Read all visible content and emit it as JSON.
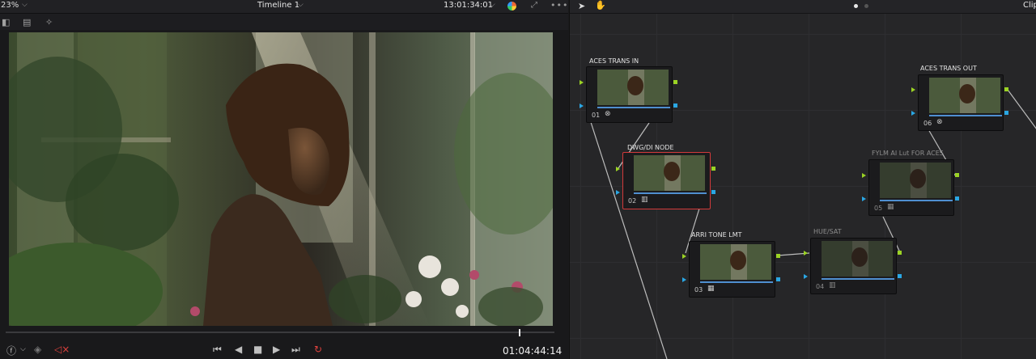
{
  "viewer": {
    "zoom": "23%",
    "timeline_name": "Timeline 1",
    "timecode": "13:01:34:01",
    "playhead_timecode": "01:04:44:14",
    "playhead_position": 0.935
  },
  "node_editor": {
    "mode_label": "Clip",
    "nodes": [
      {
        "id": "01",
        "label": "ACES TRANS IN",
        "icon": "aces-icon",
        "glyph": "⊗",
        "enabled": true,
        "selected": false
      },
      {
        "id": "02",
        "label": "DWG/DI NODE",
        "icon": "scope-icon",
        "glyph": "▥",
        "enabled": true,
        "selected": true
      },
      {
        "id": "03",
        "label": "ARRI TONE LMT",
        "icon": "lut-icon",
        "glyph": "▦",
        "enabled": true,
        "selected": false
      },
      {
        "id": "04",
        "label": "HUE/SAT",
        "icon": "scope-icon",
        "glyph": "▥",
        "enabled": false,
        "selected": false
      },
      {
        "id": "05",
        "label": "FYLM AI Lut FOR ACES",
        "icon": "lut-icon",
        "glyph": "▦",
        "enabled": false,
        "selected": false
      },
      {
        "id": "06",
        "label": "ACES TRANS OUT",
        "icon": "aces-icon",
        "glyph": "⊗",
        "enabled": true,
        "selected": false
      }
    ]
  },
  "icons": {
    "zoom_chevron": "chevron-down-icon",
    "expand": "expand-icon",
    "more": "more-icon",
    "pointer": "pointer-icon",
    "hand": "hand-icon"
  },
  "colors": {
    "selection_red": "#d23a3a",
    "rgb_port": "#9bd324",
    "alpha_port": "#2aa7e4",
    "thumb_line": "#4f8fd0"
  }
}
